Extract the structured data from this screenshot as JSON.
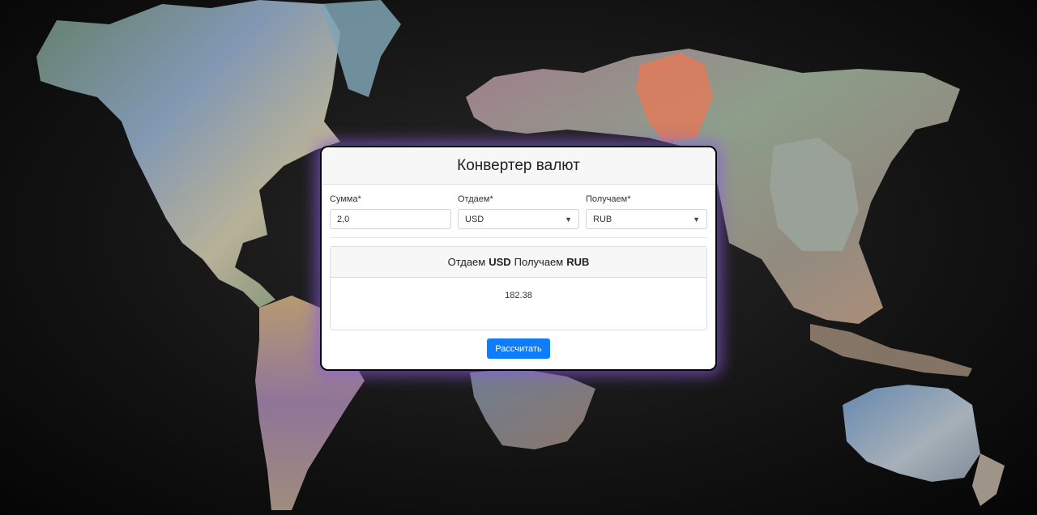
{
  "converter": {
    "title": "Конвертер валют",
    "amount_label": "Сумма*",
    "amount_value": "2,0",
    "from_label": "Отдаем*",
    "from_value": "USD",
    "to_label": "Получаем*",
    "to_value": "RUB",
    "result_give_label": "Отдаем",
    "result_give_currency": "USD",
    "result_get_label": "Получаем",
    "result_get_currency": "RUB",
    "result_value": "182.38",
    "calculate_label": "Рассчитать",
    "chevron_icon": "chevron-down-icon"
  },
  "colors": {
    "accent": "#0d7cff",
    "glow": "#8c5adc"
  }
}
